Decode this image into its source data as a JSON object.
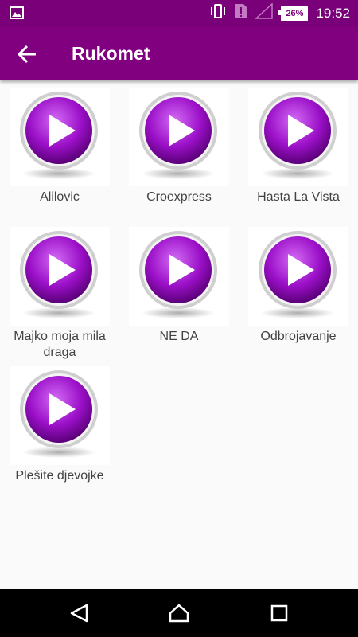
{
  "status_bar": {
    "time": "19:52",
    "battery": "26%"
  },
  "app_bar": {
    "title": "Rukomet"
  },
  "songs": [
    {
      "label": "Alilovic"
    },
    {
      "label": "Croexpress"
    },
    {
      "label": "Hasta La Vista"
    },
    {
      "label": "Majko moja mila draga"
    },
    {
      "label": "NE DA"
    },
    {
      "label": "Odbrojavanje"
    },
    {
      "label": "Plešite djevojke"
    }
  ],
  "colors": {
    "primary": "#800080",
    "status_bar": "#7a007a",
    "play_purple": "#9b10c8"
  }
}
